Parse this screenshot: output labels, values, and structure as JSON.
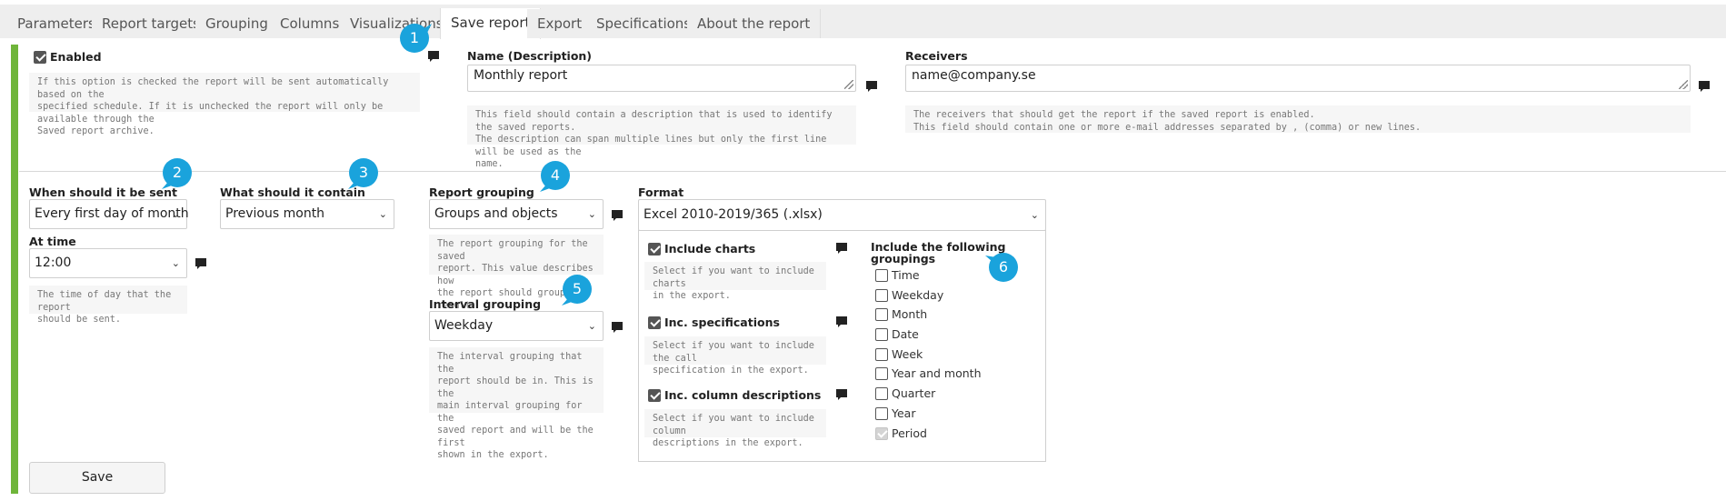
{
  "tabs": [
    {
      "label": "Parameters"
    },
    {
      "label": "Report targets"
    },
    {
      "label": "Grouping"
    },
    {
      "label": "Columns"
    },
    {
      "label": "Visualizations"
    },
    {
      "label": "Save report"
    },
    {
      "label": "Export"
    },
    {
      "label": "Specifications"
    },
    {
      "label": "About the report"
    }
  ],
  "enabled": {
    "label": "Enabled",
    "checked": true,
    "help": [
      "If this option is checked the report will be sent automatically based on the",
      "specified schedule. If it is unchecked the report will only be available through the",
      "Saved report archive."
    ]
  },
  "name": {
    "label": "Name (Description)",
    "value": "Monthly report",
    "help": [
      "This field should contain a description that is used to identify the saved reports.",
      "The description can span multiple lines but only the first line will be used as the",
      "name."
    ]
  },
  "receivers": {
    "label": "Receivers",
    "value": "name@company.se",
    "help": [
      "The receivers that should get the report if the saved report is enabled.",
      "This field should contain one or more e-mail addresses separated by , (comma) or new lines."
    ]
  },
  "when": {
    "label": "When should it be sent",
    "value": "Every first day of month"
  },
  "time": {
    "label": "At time",
    "value": "12:00",
    "help": [
      "The time of day that the report",
      "should be sent."
    ]
  },
  "contain": {
    "label": "What should it contain",
    "value": "Previous month"
  },
  "report_grouping": {
    "label": "Report grouping",
    "value": "Groups and objects",
    "help": [
      "The report grouping for the saved",
      "report. This value describes how",
      "the report should group the result."
    ]
  },
  "interval_grouping": {
    "label": "Interval grouping",
    "value": "Weekday",
    "help": [
      "The interval grouping that the",
      "report should be in. This is the",
      "main interval grouping for the",
      "saved report and will be the first",
      "shown in the export."
    ]
  },
  "format": {
    "label": "Format",
    "value": "Excel 2010-2019/365 (.xlsx)"
  },
  "export_options": [
    {
      "label": "Include charts",
      "checked": true,
      "help": [
        "Select if you want to include charts",
        "in the export."
      ]
    },
    {
      "label": "Inc. specifications",
      "checked": true,
      "help": [
        "Select if you want to include the call",
        "specification in the export."
      ]
    },
    {
      "label": "Inc. column descriptions",
      "checked": true,
      "help": [
        "Select if you want to include column",
        "descriptions in the export."
      ]
    }
  ],
  "groupings": {
    "label_line1": "Include the following",
    "label_line2": "groupings",
    "items": [
      {
        "label": "Time",
        "checked": false
      },
      {
        "label": "Weekday",
        "checked": false
      },
      {
        "label": "Month",
        "checked": false
      },
      {
        "label": "Date",
        "checked": false
      },
      {
        "label": "Week",
        "checked": false
      },
      {
        "label": "Year and month",
        "checked": false
      },
      {
        "label": "Quarter",
        "checked": false
      },
      {
        "label": "Year",
        "checked": false
      },
      {
        "label": "Period",
        "checked": true,
        "disabled": true
      }
    ]
  },
  "save_label": "Save",
  "badges": [
    "1",
    "2",
    "3",
    "4",
    "5",
    "6"
  ],
  "colors": {
    "accent_green": "#6fb53a",
    "badge_blue": "#1aa3dc"
  }
}
